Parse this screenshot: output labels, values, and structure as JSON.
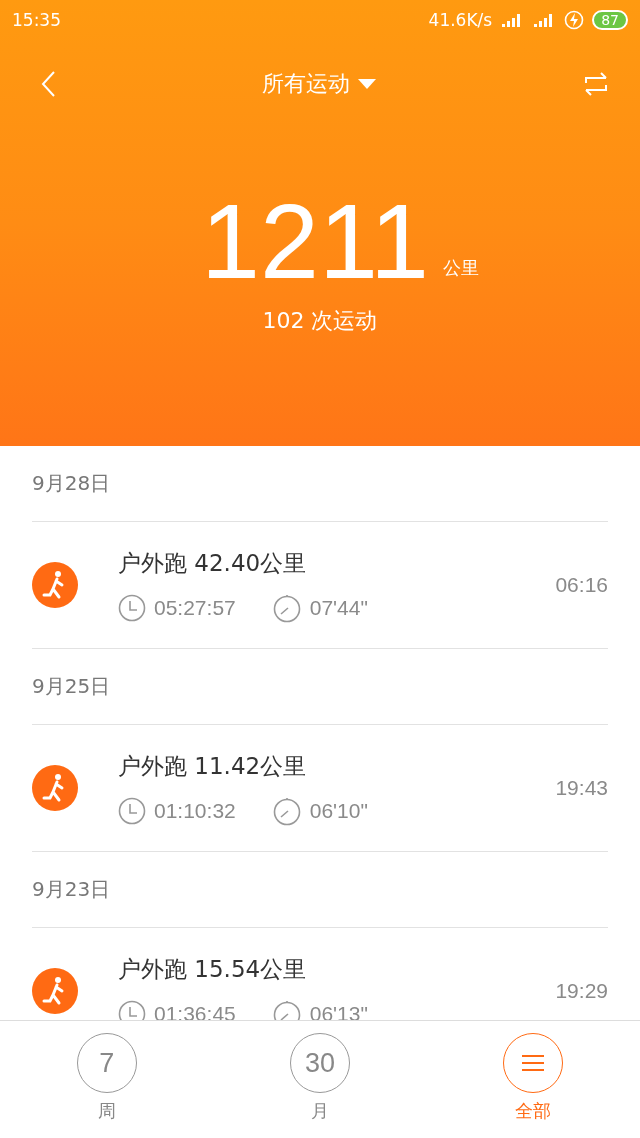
{
  "status_bar": {
    "time": "15:35",
    "speed": "41.6K/s",
    "battery": "87"
  },
  "header": {
    "title": "所有运动",
    "total": "1211",
    "unit": "公里",
    "count": "102 次运动"
  },
  "days": [
    {
      "date": "9月28日",
      "workouts": [
        {
          "name": "户外跑 42.40公里",
          "duration": "05:27:57",
          "pace": "07'44\"",
          "time": "06:16"
        }
      ]
    },
    {
      "date": "9月25日",
      "workouts": [
        {
          "name": "户外跑 11.42公里",
          "duration": "01:10:32",
          "pace": "06'10\"",
          "time": "19:43"
        }
      ]
    },
    {
      "date": "9月23日",
      "workouts": [
        {
          "name": "户外跑 15.54公里",
          "duration": "01:36:45",
          "pace": "06'13\"",
          "time": "19:29"
        }
      ]
    }
  ],
  "tabs": [
    {
      "kind": "number",
      "value": "7",
      "label": "周",
      "selected": false
    },
    {
      "kind": "number",
      "value": "30",
      "label": "月",
      "selected": false
    },
    {
      "kind": "menu",
      "label": "全部",
      "selected": true
    }
  ]
}
